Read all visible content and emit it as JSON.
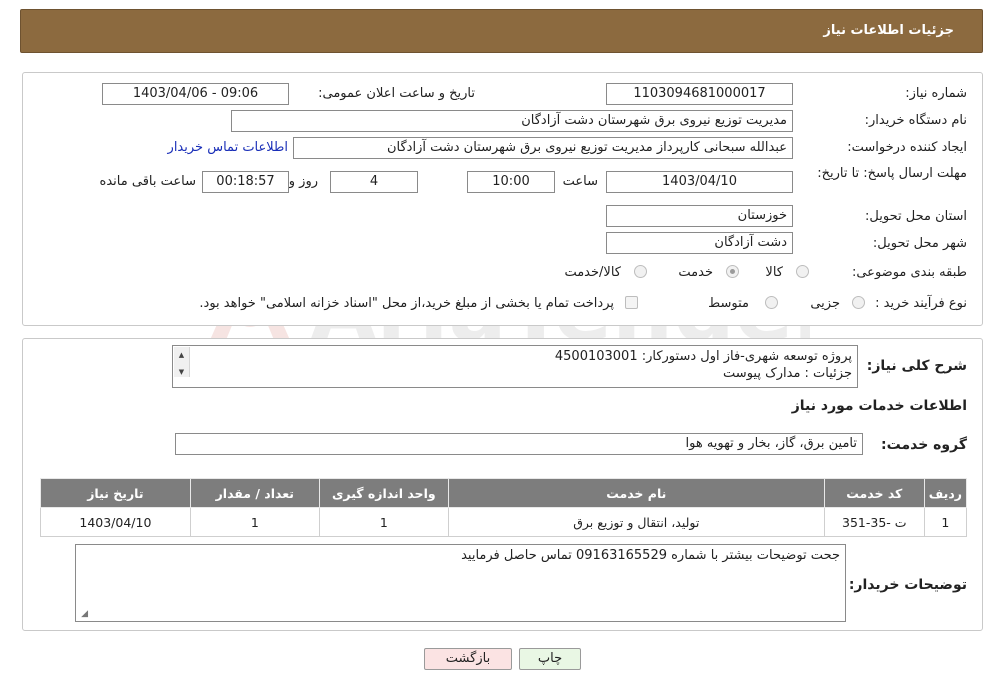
{
  "header": {
    "title": "جزئیات اطلاعات نیاز"
  },
  "details": {
    "need_number_label": "شماره نیاز:",
    "need_number": "1103094681000017",
    "announce_label": "تاریخ و ساعت اعلان عمومی:",
    "announce_value": "1403/04/06 - 09:06",
    "buyer_org_label": "نام دستگاه خریدار:",
    "buyer_org": "مدیریت توزیع نیروی برق شهرستان دشت آزادگان",
    "creator_label": "ایجاد کننده درخواست:",
    "creator": "عبدالله سبحانی کارپرداز مدیریت توزیع نیروی برق شهرستان دشت آزادگان",
    "contact_link": "اطلاعات تماس خریدار",
    "deadline_label": "مهلت ارسال پاسخ: تا تاریخ:",
    "deadline_date": "1403/04/10",
    "time_label": "ساعت",
    "deadline_time": "10:00",
    "days_value": "4",
    "days_label": "روز و",
    "remaining_time": "00:18:57",
    "remaining_label": "ساعت باقی مانده",
    "province_label": "استان محل تحویل:",
    "province": "خوزستان",
    "city_label": "شهر محل تحویل:",
    "city": "دشت آزادگان",
    "category_label": "طبقه بندی موضوعی:",
    "category_options": [
      {
        "label": "کالا",
        "checked": false
      },
      {
        "label": "خدمت",
        "checked": true
      },
      {
        "label": "کالا/خدمت",
        "checked": false
      }
    ],
    "purchase_type_label": "نوع فرآیند خرید :",
    "purchase_options": [
      {
        "label": "جزیی",
        "checked": false
      },
      {
        "label": "متوسط",
        "checked": false
      }
    ],
    "payment_note": "پرداخت تمام یا بخشی از مبلغ خرید،از محل \"اسناد خزانه اسلامی\" خواهد بود."
  },
  "summary": {
    "label": "شرح کلی نیاز:",
    "line1": "پروژه توسعه شهری-فاز اول  دستورکار: 4500103001",
    "line2": "جزئیات : مدارک پیوست"
  },
  "services": {
    "section_title": "اطلاعات خدمات مورد نیاز",
    "group_label": "گروه خدمت:",
    "group_value": "تامین برق، گاز، بخار و تهویه هوا",
    "table": {
      "headers": [
        "ردیف",
        "کد خدمت",
        "نام خدمت",
        "واحد اندازه گیری",
        "تعداد / مقدار",
        "تاریخ نیاز"
      ],
      "rows": [
        [
          "1",
          "ت -35-351",
          "تولید، انتقال و توزیع برق",
          "1",
          "1",
          "1403/04/10"
        ]
      ]
    }
  },
  "buyer_notes": {
    "label": "توضیحات خریدار:",
    "text": "جحت توضیحات بیشتر با شماره 09163165529 تماس حاصل فرمایید"
  },
  "buttons": {
    "print": "چاپ",
    "back": "بازگشت"
  },
  "watermark": {
    "text": "AriaTender.neT"
  }
}
